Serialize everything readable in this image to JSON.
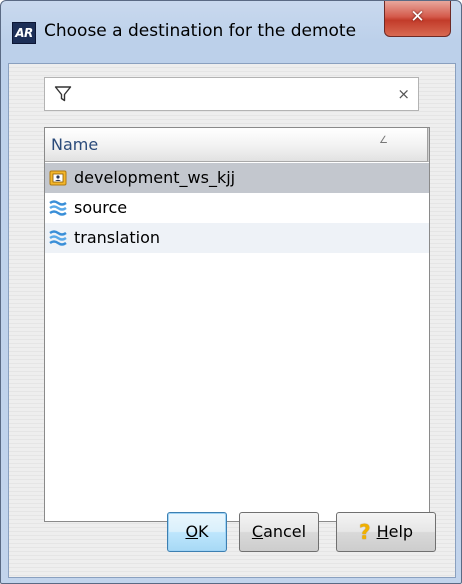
{
  "window": {
    "app_icon_text": "AR",
    "title": "Choose a destination for the demote",
    "close_glyph": "✕"
  },
  "filter": {
    "icon": "filter-icon",
    "value": "",
    "placeholder": "",
    "clear_glyph": "×"
  },
  "list": {
    "columns": [
      {
        "label": "Name",
        "sort_glyph": "∠"
      }
    ],
    "rows": [
      {
        "label": "development_ws_kjj",
        "icon": "workspace-icon",
        "selected": true
      },
      {
        "label": "source",
        "icon": "stream-icon",
        "selected": false
      },
      {
        "label": "translation",
        "icon": "stream-icon",
        "selected": false
      }
    ]
  },
  "buttons": {
    "ok": {
      "mnemonic": "O",
      "rest": "K"
    },
    "cancel": {
      "mnemonic": "C",
      "rest": "ancel"
    },
    "help": {
      "icon_glyph": "?",
      "mnemonic": "H",
      "rest": "elp"
    }
  },
  "colors": {
    "selection": "#c3c7ce",
    "alt_row": "#eef2f7",
    "close_button": "#c23b2a",
    "header_text": "#2a4a7a"
  }
}
